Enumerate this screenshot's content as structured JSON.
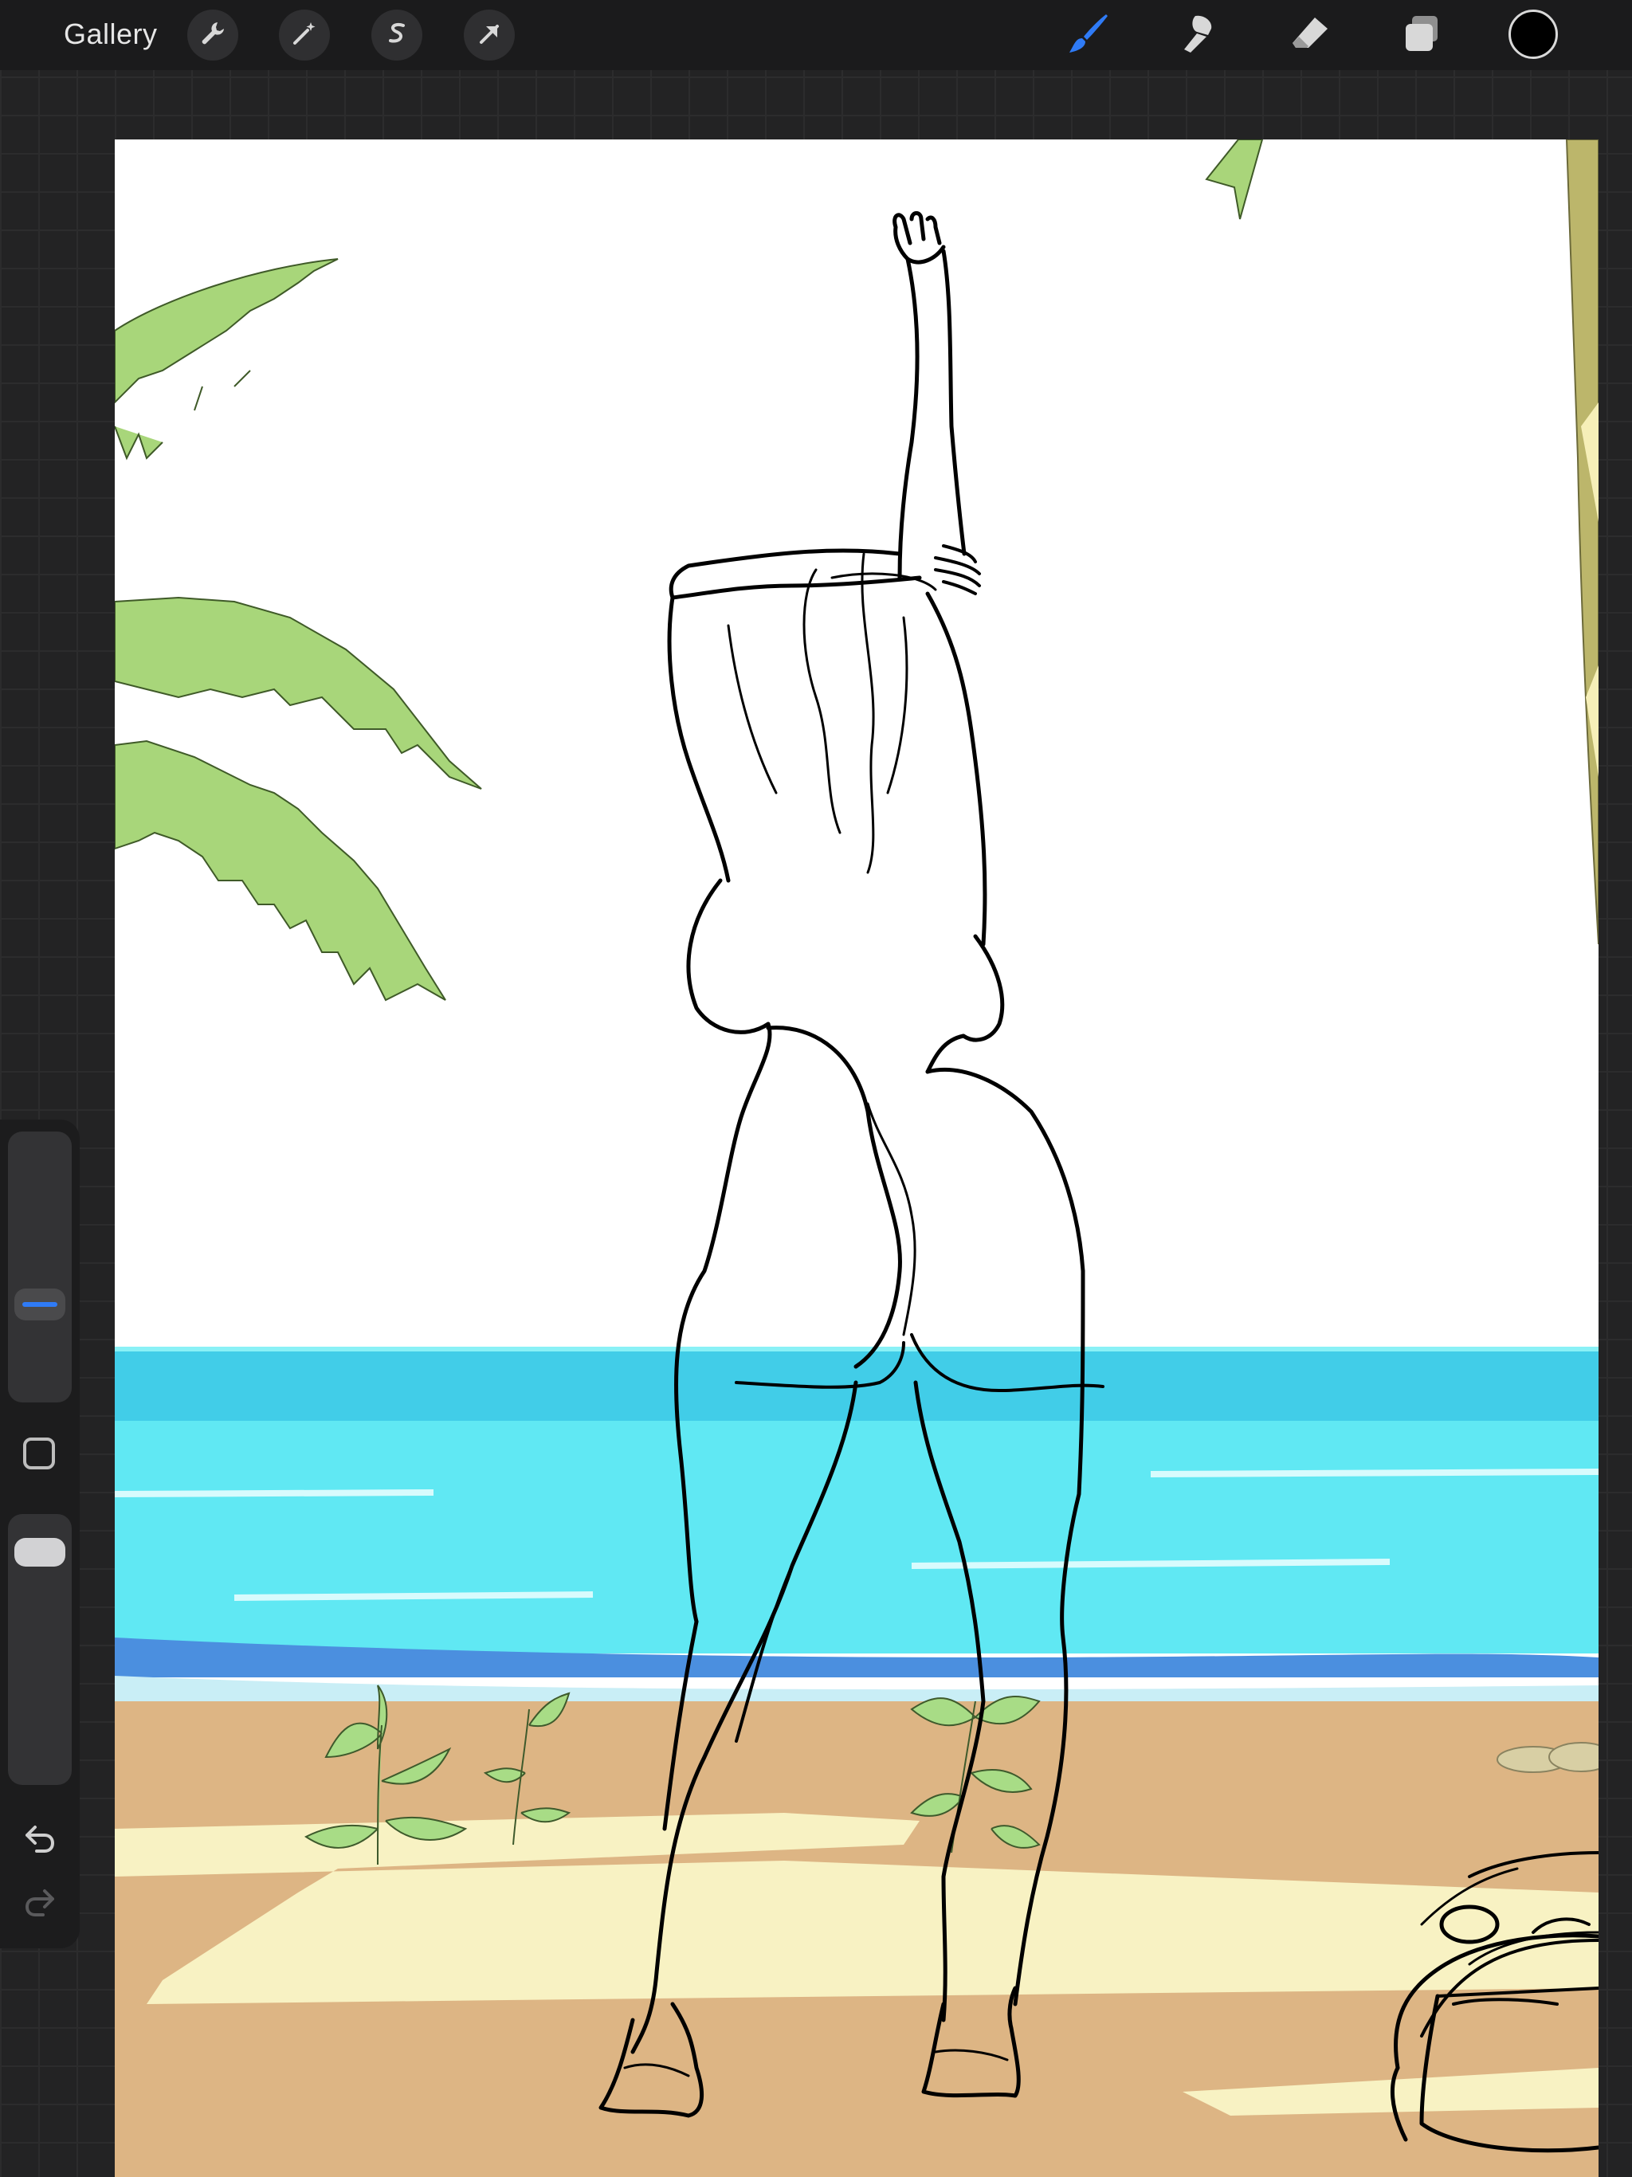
{
  "topbar": {
    "gallery_label": "Gallery",
    "left_tools": [
      {
        "name": "actions-wrench-icon"
      },
      {
        "name": "adjustments-magic-wand-icon"
      },
      {
        "name": "selection-s-icon"
      },
      {
        "name": "transform-arrow-icon"
      }
    ],
    "right_tools": [
      {
        "name": "brush-icon",
        "active": true
      },
      {
        "name": "smudge-icon",
        "active": false
      },
      {
        "name": "eraser-icon",
        "active": false
      },
      {
        "name": "layers-icon",
        "active": false
      }
    ],
    "current_color": "#000000",
    "accent_color": "#2f7bf6"
  },
  "sidebar": {
    "brush_size_level": 0.33,
    "brush_opacity_level": 0.9,
    "buttons": [
      "modify-button",
      "undo-button",
      "redo-button"
    ]
  },
  "canvas": {
    "colors": {
      "sky": "#ffffff",
      "sea": "#5fe6f2",
      "shore": "#4a90e2",
      "sand": "#ddb584",
      "sand_light": "#f8f2c4",
      "leaf": "#a8d67a",
      "trunk": "#b9b56a",
      "line": "#000000"
    }
  }
}
